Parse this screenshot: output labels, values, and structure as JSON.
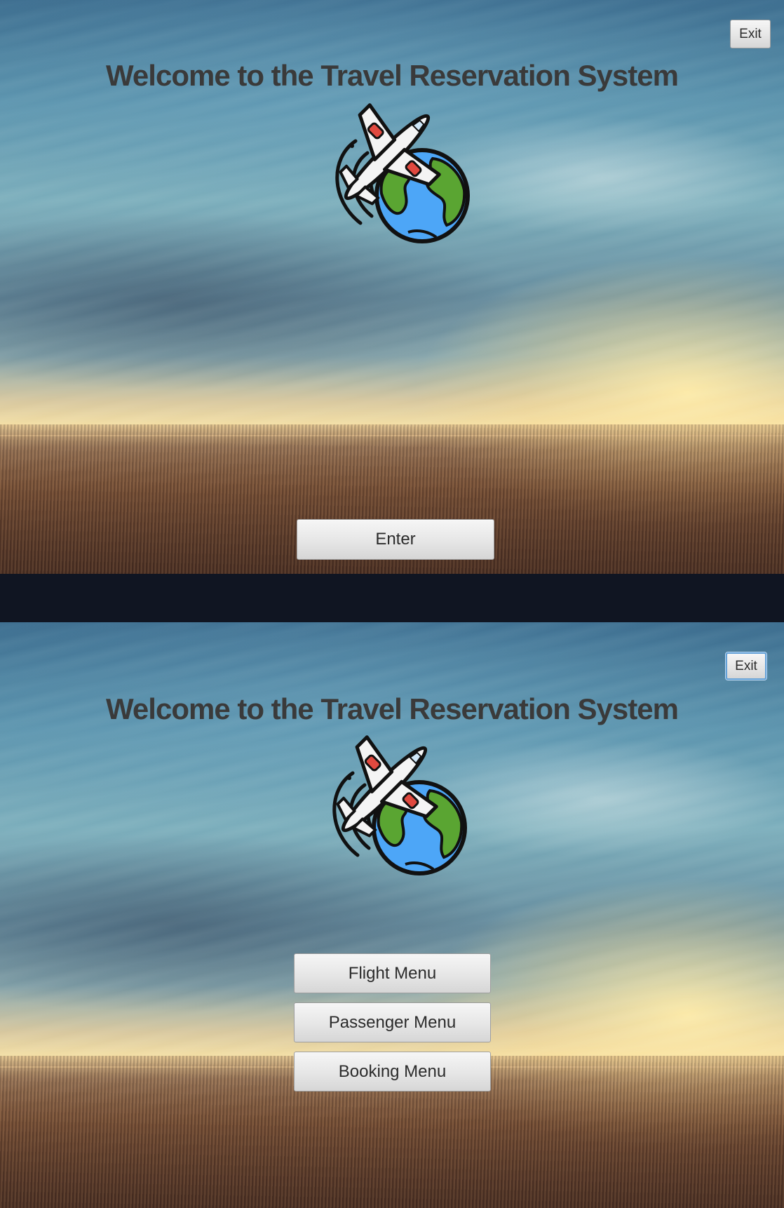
{
  "screens": [
    {
      "title": "Welcome to the Travel Reservation System",
      "exit_label": "Exit",
      "logo_icon": "airplane-globe-icon",
      "buttons": [
        {
          "label": "Enter"
        }
      ]
    },
    {
      "title": "Welcome to the Travel Reservation System",
      "exit_label": "Exit",
      "logo_icon": "airplane-globe-icon",
      "buttons": [
        {
          "label": "Flight Menu"
        },
        {
          "label": "Passenger Menu"
        },
        {
          "label": "Booking Menu"
        }
      ]
    }
  ],
  "colors": {
    "divider": "#101522",
    "title_text": "#3a3a3a",
    "globe_ocean": "#4da6f7",
    "globe_land": "#5aa532",
    "plane_body": "#f4f4f4",
    "plane_engines": "#e0493f",
    "focus_ring": "#64a2d8"
  }
}
